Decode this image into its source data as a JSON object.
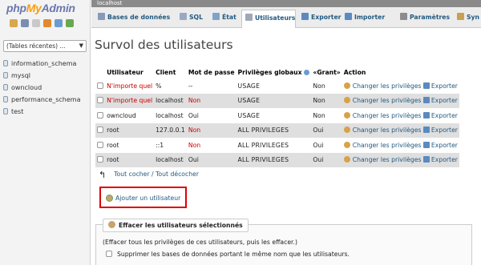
{
  "nav": {
    "logo_php": "php",
    "logo_my": "My",
    "logo_admin": "Admin",
    "icons": [
      "home-icon",
      "exit-icon",
      "docs-icon",
      "help-icon",
      "settings-icon",
      "reload-icon"
    ],
    "db_select": "(Tables récentes) ...",
    "databases": [
      "information_schema",
      "mysql",
      "owncloud",
      "performance_schema",
      "test"
    ]
  },
  "serverbar": {
    "server": "localhost"
  },
  "tabs": [
    {
      "label": "Bases de données",
      "icon": "database-icon",
      "active": false
    },
    {
      "label": "SQL",
      "icon": "sql-icon",
      "active": false
    },
    {
      "label": "État",
      "icon": "status-icon",
      "active": false
    },
    {
      "label": "Utilisateurs",
      "icon": "users-icon",
      "active": true
    },
    {
      "label": "Exporter",
      "icon": "export-icon",
      "active": false
    },
    {
      "label": "Importer",
      "icon": "import-icon",
      "active": false
    },
    {
      "label": "Paramètres",
      "icon": "wrench-icon",
      "active": false
    },
    {
      "label": "Syn",
      "icon": "sync-icon",
      "active": false
    }
  ],
  "page": {
    "title": "Survol des utilisateurs"
  },
  "table": {
    "headers": {
      "user": "Utilisateur",
      "host": "Client",
      "password": "Mot de passe",
      "privileges": "Privilèges globaux",
      "grant": "«Grant»",
      "action": "Action"
    },
    "rows": [
      {
        "user": "N'importe quel",
        "host": "%",
        "password": "--",
        "privileges": "USAGE",
        "grant": "Non",
        "edit": "Changer les privilèges",
        "export": "Exporter"
      },
      {
        "user": "N'importe quel",
        "host": "localhost",
        "password": "Non",
        "privileges": "USAGE",
        "grant": "Non",
        "edit": "Changer les privilèges",
        "export": "Exporter"
      },
      {
        "user": "owncloud",
        "host": "localhost",
        "password": "Oui",
        "privileges": "USAGE",
        "grant": "Non",
        "edit": "Changer les privilèges",
        "export": "Exporter"
      },
      {
        "user": "root",
        "host": "127.0.0.1",
        "password": "Non",
        "privileges": "ALL PRIVILEGES",
        "grant": "Oui",
        "edit": "Changer les privilèges",
        "export": "Exporter"
      },
      {
        "user": "root",
        "host": "::1",
        "password": "Non",
        "privileges": "ALL PRIVILEGES",
        "grant": "Oui",
        "edit": "Changer les privilèges",
        "export": "Exporter"
      },
      {
        "user": "root",
        "host": "localhost",
        "password": "Oui",
        "privileges": "ALL PRIVILEGES",
        "grant": "Oui",
        "edit": "Changer les privilèges",
        "export": "Exporter"
      }
    ]
  },
  "check_all": "Tout cocher / Tout décocher",
  "add_user": "Ajouter un utilisateur",
  "delete_section": {
    "legend": "Effacer les utilisateurs sélectionnés",
    "description": "(Effacer tous les privilèges de ces utilisateurs, puis les effacer.)",
    "drop_db_label": "Supprimer les bases de données portant le même nom que les utilisateurs."
  },
  "colors": {
    "link": "#235a81",
    "alert_red": "#cc0000",
    "highlight_box": "#e00000",
    "server_bar": "#8a8a8a"
  }
}
